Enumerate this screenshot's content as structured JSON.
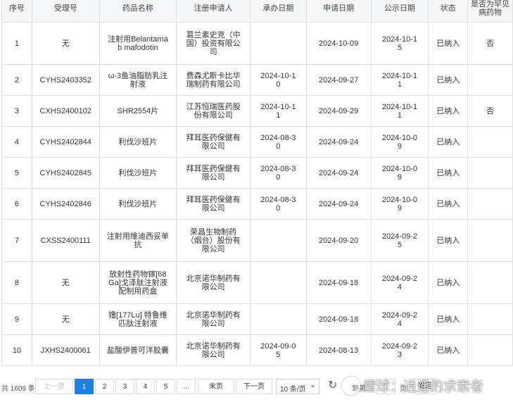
{
  "table": {
    "headers": {
      "no": "序号",
      "accept_no": "受理号",
      "drug_name": "药品名称",
      "applicant": "注册申请人",
      "undertake_date": "承办日期",
      "apply_date": "申请日期",
      "publicity_date": "公示日期",
      "status": "状态",
      "rare_disease": "是否为罕见病药物"
    },
    "rows": [
      {
        "no": "1",
        "accept_no": "无",
        "drug_name": "注射用Belantamab mafodotin",
        "applicant": "葛兰素史克（中国）投资有限公司",
        "undertake_date": "",
        "apply_date": "2024-10-09",
        "publicity_date": "2024-10-15",
        "status": "已纳入",
        "rare_disease": "否"
      },
      {
        "no": "2",
        "accept_no": "CYHS2403352",
        "drug_name": "ω-3鱼油脂肪乳注射液",
        "applicant": "费森尤斯卡比华瑞制药有限公司",
        "undertake_date": "2024-10-10",
        "apply_date": "2024-09-27",
        "publicity_date": "2024-10-11",
        "status": "已纳入",
        "rare_disease": ""
      },
      {
        "no": "3",
        "accept_no": "CXHS2400102",
        "drug_name": "SHR2554片",
        "applicant": "江苏恒瑞医药股份有限公司",
        "undertake_date": "2024-10-11",
        "apply_date": "2024-09-29",
        "publicity_date": "2024-10-11",
        "status": "已纳入",
        "rare_disease": "否"
      },
      {
        "no": "4",
        "accept_no": "CYHS2402844",
        "drug_name": "利伐沙班片",
        "applicant": "拜耳医药保健有限公司",
        "undertake_date": "2024-08-30",
        "apply_date": "2024-09-24",
        "publicity_date": "2024-10-09",
        "status": "已纳入",
        "rare_disease": ""
      },
      {
        "no": "5",
        "accept_no": "CYHS2402845",
        "drug_name": "利伐沙班片",
        "applicant": "拜耳医药保健有限公司",
        "undertake_date": "2024-08-30",
        "apply_date": "2024-09-24",
        "publicity_date": "2024-10-09",
        "status": "已纳入",
        "rare_disease": ""
      },
      {
        "no": "6",
        "accept_no": "CYHS2402846",
        "drug_name": "利伐沙班片",
        "applicant": "拜耳医药保健有限公司",
        "undertake_date": "2024-08-30",
        "apply_date": "2024-09-24",
        "publicity_date": "2024-10-09",
        "status": "已纳入",
        "rare_disease": ""
      },
      {
        "no": "7",
        "accept_no": "CXSS2400111",
        "drug_name": "注射用维迪西妥单抗",
        "applicant": "荣昌生物制药（烟台）股份有限公司",
        "undertake_date": "",
        "apply_date": "2024-09-20",
        "publicity_date": "2024-09-25",
        "status": "已纳入",
        "rare_disease": ""
      },
      {
        "no": "8",
        "accept_no": "无",
        "drug_name": "放射性药物镓[68Ga]戈泽肽注射液配制用药盒",
        "applicant": "北京诺华制药有限公司",
        "undertake_date": "",
        "apply_date": "2024-09-18",
        "publicity_date": "2024-09-24",
        "status": "已纳入",
        "rare_disease": ""
      },
      {
        "no": "9",
        "accept_no": "无",
        "drug_name": "镥[177Lu] 特鲁维匹肽注射液",
        "applicant": "北京诺华制药有限公司",
        "undertake_date": "",
        "apply_date": "2024-09-18",
        "publicity_date": "2024-09-24",
        "status": "已纳入",
        "rare_disease": ""
      },
      {
        "no": "10",
        "accept_no": "JXHS2400061",
        "drug_name": "盐酸伊普可泮胶囊",
        "applicant": "北京诺华制药有限公司",
        "undertake_date": "2024-09-05",
        "apply_date": "2024-08-13",
        "publicity_date": "2024-09-23",
        "status": "已纳入",
        "rare_disease": ""
      }
    ]
  },
  "pagination": {
    "total": "共 1609 条",
    "prev": "上一页",
    "pages": [
      "1",
      "2",
      "3",
      "4",
      "5"
    ],
    "ellipsis": "...",
    "last_page": "末页",
    "next": "下一页",
    "page_size": "10 条/页",
    "goto_prefix": "到第",
    "goto_value": "1",
    "goto_suffix": "页",
    "confirm": "确定"
  },
  "watermark": "雪球：逍遥的求索者",
  "colors": {
    "accent": "#1e7fe0",
    "header_bg": "#f5f6f7",
    "border": "#e0e0e0"
  }
}
